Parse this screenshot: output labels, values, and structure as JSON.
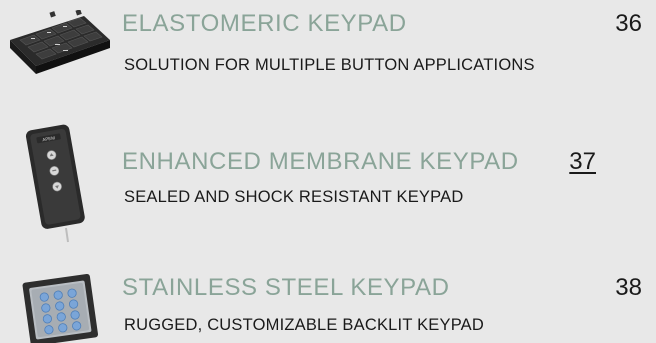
{
  "items": [
    {
      "title": "ELASTOMERIC KEYPAD",
      "page": "36",
      "subtitle": "SOLUTION FOR MULTIPLE BUTTON APPLICATIONS",
      "icon": "elastomeric-keypad-image"
    },
    {
      "title": "ENHANCED MEMBRANE KEYPAD",
      "page": "37",
      "subtitle": "SEALED AND SHOCK RESISTANT KEYPAD",
      "icon": "membrane-keypad-image",
      "logo_text": "APEM"
    },
    {
      "title": "STAINLESS STEEL KEYPAD",
      "page": "38",
      "subtitle": "RUGGED, CUSTOMIZABLE BACKLIT KEYPAD",
      "icon": "stainless-steel-keypad-image"
    }
  ],
  "colors": {
    "background": "#e8e8e8",
    "title": "#8aa498",
    "text": "#1a1a1a"
  }
}
